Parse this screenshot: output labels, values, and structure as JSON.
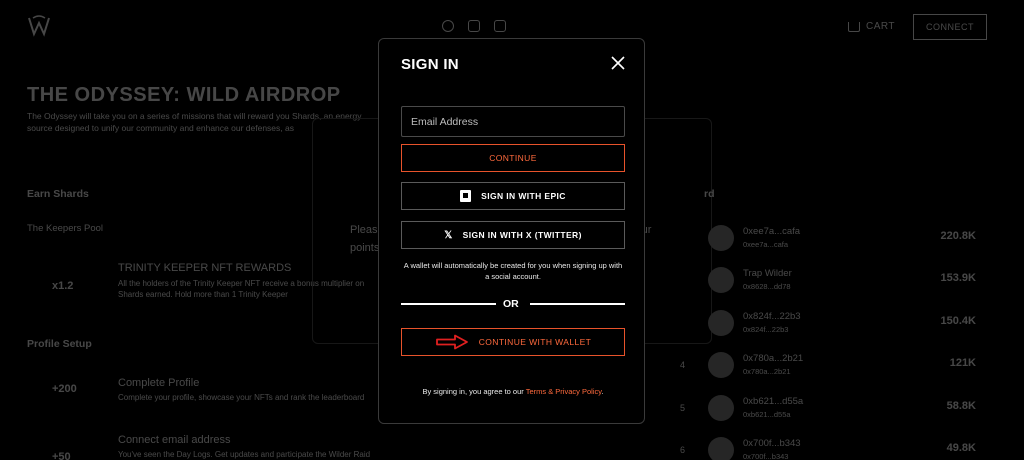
{
  "header": {
    "cart_label": "CART",
    "connect_label": "CONNECT"
  },
  "page": {
    "title": "THE ODYSSEY: WILD AIRDROP",
    "intro": "The Odyssey will take you on a series of missions that will reward you Shards, an energy source designed to unify our community and enhance our defenses, as",
    "earn_shards": "Earn Shards",
    "keepers_pool": "The Keepers Pool",
    "keeper_multiplier": "x1.2",
    "keeper_task_title": "TRINITY KEEPER NFT REWARDS",
    "keeper_task_desc": "All the holders of the Trinity Keeper NFT receive a bonus multiplier on Shards earned. Hold more than 1 Trinity Keeper",
    "profile_setup": "Profile Setup",
    "profile_points": "+200",
    "profile_task_title": "Complete Profile",
    "profile_task_desc": "Complete your profile, showcase your NFTs and rank the leaderboard",
    "email_points": "+50",
    "email_task_title": "Connect email address",
    "email_task_desc": "You've seen the Day Logs. Get updates and participate the Wilder Raid calendar daily",
    "gate_text": "Please connect your wallet or sign in to register and view your points.",
    "leaderboard_title": "rd"
  },
  "leaderboard": [
    {
      "rank": "",
      "name": "0xee7a...cafa",
      "addr": "0xee7a...cafa",
      "score": "220.8K"
    },
    {
      "rank": "",
      "name": "Trap Wilder",
      "addr": "0x8628...dd78",
      "score": "153.9K"
    },
    {
      "rank": "",
      "name": "0x824f...22b3",
      "addr": "0x824f...22b3",
      "score": "150.4K"
    },
    {
      "rank": "4",
      "name": "0x780a...2b21",
      "addr": "0x780a...2b21",
      "score": "121K"
    },
    {
      "rank": "5",
      "name": "0xb621...d55a",
      "addr": "0xb621...d55a",
      "score": "58.8K"
    },
    {
      "rank": "6",
      "name": "0x700f...b343",
      "addr": "0x700f...b343",
      "score": "49.8K"
    }
  ],
  "modal": {
    "title": "SIGN IN",
    "email_placeholder": "Email Address",
    "continue_label": "CONTINUE",
    "epic_label": "SIGN IN WITH EPIC",
    "x_label": "SIGN IN WITH X (TWITTER)",
    "x_glyph": "𝕏",
    "note": "A wallet will automatically be created for you when signing up with a social account.",
    "or_label": "OR",
    "wallet_label": "CONTINUE WITH WALLET",
    "terms_prefix": "By signing in, you agree to our ",
    "terms_link": "Terms & Privacy Policy",
    "terms_suffix": "."
  },
  "colors": {
    "accent": "#ff6a3d",
    "accent_border": "#e8532b",
    "arrow": "#e02020",
    "background": "#000000"
  }
}
